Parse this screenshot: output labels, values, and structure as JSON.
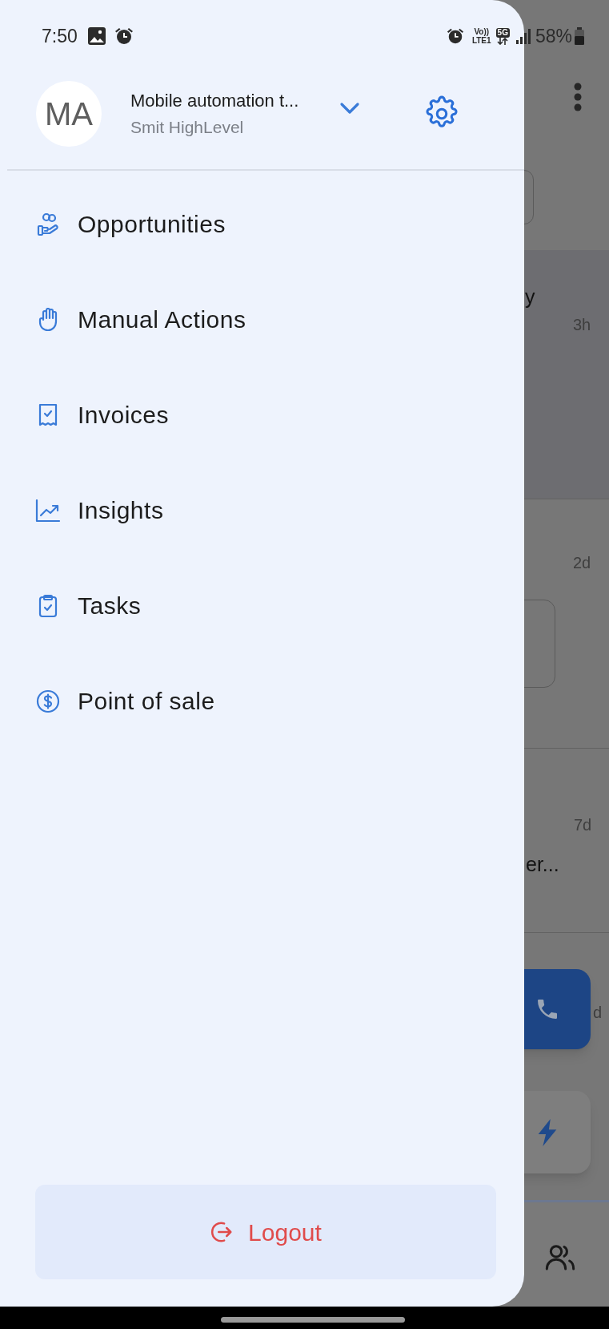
{
  "status_bar": {
    "time": "7:50",
    "volte_top": "Vo))",
    "volte_bottom": "LTE1",
    "network": "5G",
    "battery": "58%"
  },
  "account": {
    "initials": "MA",
    "name": "Mobile automation t...",
    "subtitle": "Smit HighLevel"
  },
  "menu": [
    {
      "label": "Opportunities"
    },
    {
      "label": "Manual Actions"
    },
    {
      "label": "Invoices"
    },
    {
      "label": "Insights"
    },
    {
      "label": "Tasks"
    },
    {
      "label": "Point of sale"
    }
  ],
  "logout": "Logout",
  "background_rows": [
    {
      "text": "y",
      "time": "3h"
    },
    {
      "time": "2d"
    },
    {
      "text": "er...",
      "time": "7d"
    },
    {
      "time": "d"
    }
  ]
}
